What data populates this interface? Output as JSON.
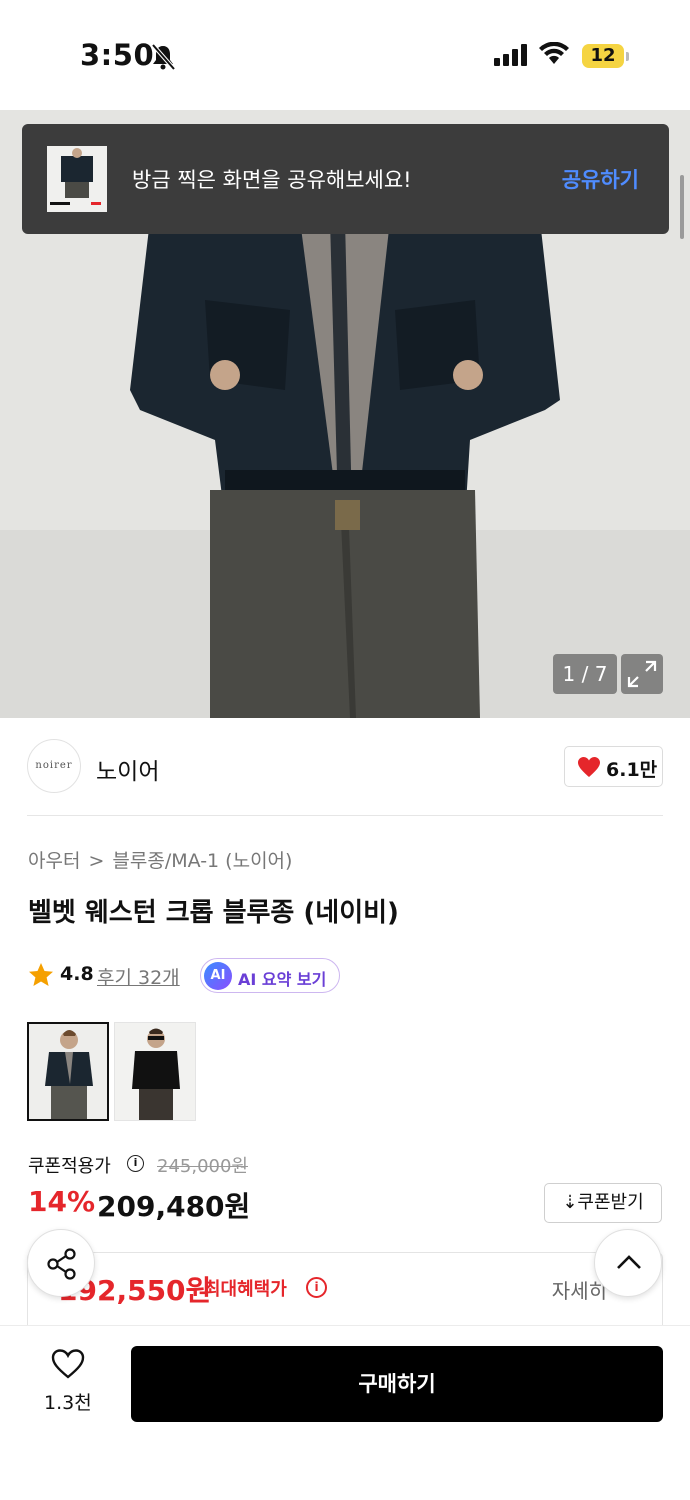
{
  "status_bar": {
    "time": "3:50",
    "battery": "12"
  },
  "toast": {
    "message": "방금 찍은 화면을 공유해보세요!",
    "action": "공유하기"
  },
  "gallery": {
    "counter": "1 / 7",
    "thumb_chevron": "›"
  },
  "brand": {
    "logo_text": "noirer",
    "name": "노이어",
    "likes": "6.1만"
  },
  "breadcrumb": [
    "아우터",
    "블루종/MA-1 (노이어)"
  ],
  "breadcrumb_sep": ">",
  "product": {
    "title": "벨벳 웨스턴 크롭 블루종 (네이비)"
  },
  "rating": {
    "value": "4.8",
    "reviews": "후기 32개",
    "ai_icon": "AI",
    "ai_label": "AI 요약 보기"
  },
  "variants": [
    "navy",
    "black"
  ],
  "price": {
    "coupon_label": "쿠폰적용가",
    "info_glyph": "i",
    "original": "245,000원",
    "discount": "14%",
    "sale": "209,480원",
    "coupon_button": "⇣쿠폰받기"
  },
  "benefit": {
    "price": "192,550원",
    "label": "최대혜택가",
    "detail": "자세히"
  },
  "bottom": {
    "wish_count": "1.3천",
    "buy_label": "구매하기"
  },
  "colors": {
    "accent_red": "#e5262b",
    "link_blue": "#4f8cff",
    "ai_purple": "#6a3fd6"
  }
}
